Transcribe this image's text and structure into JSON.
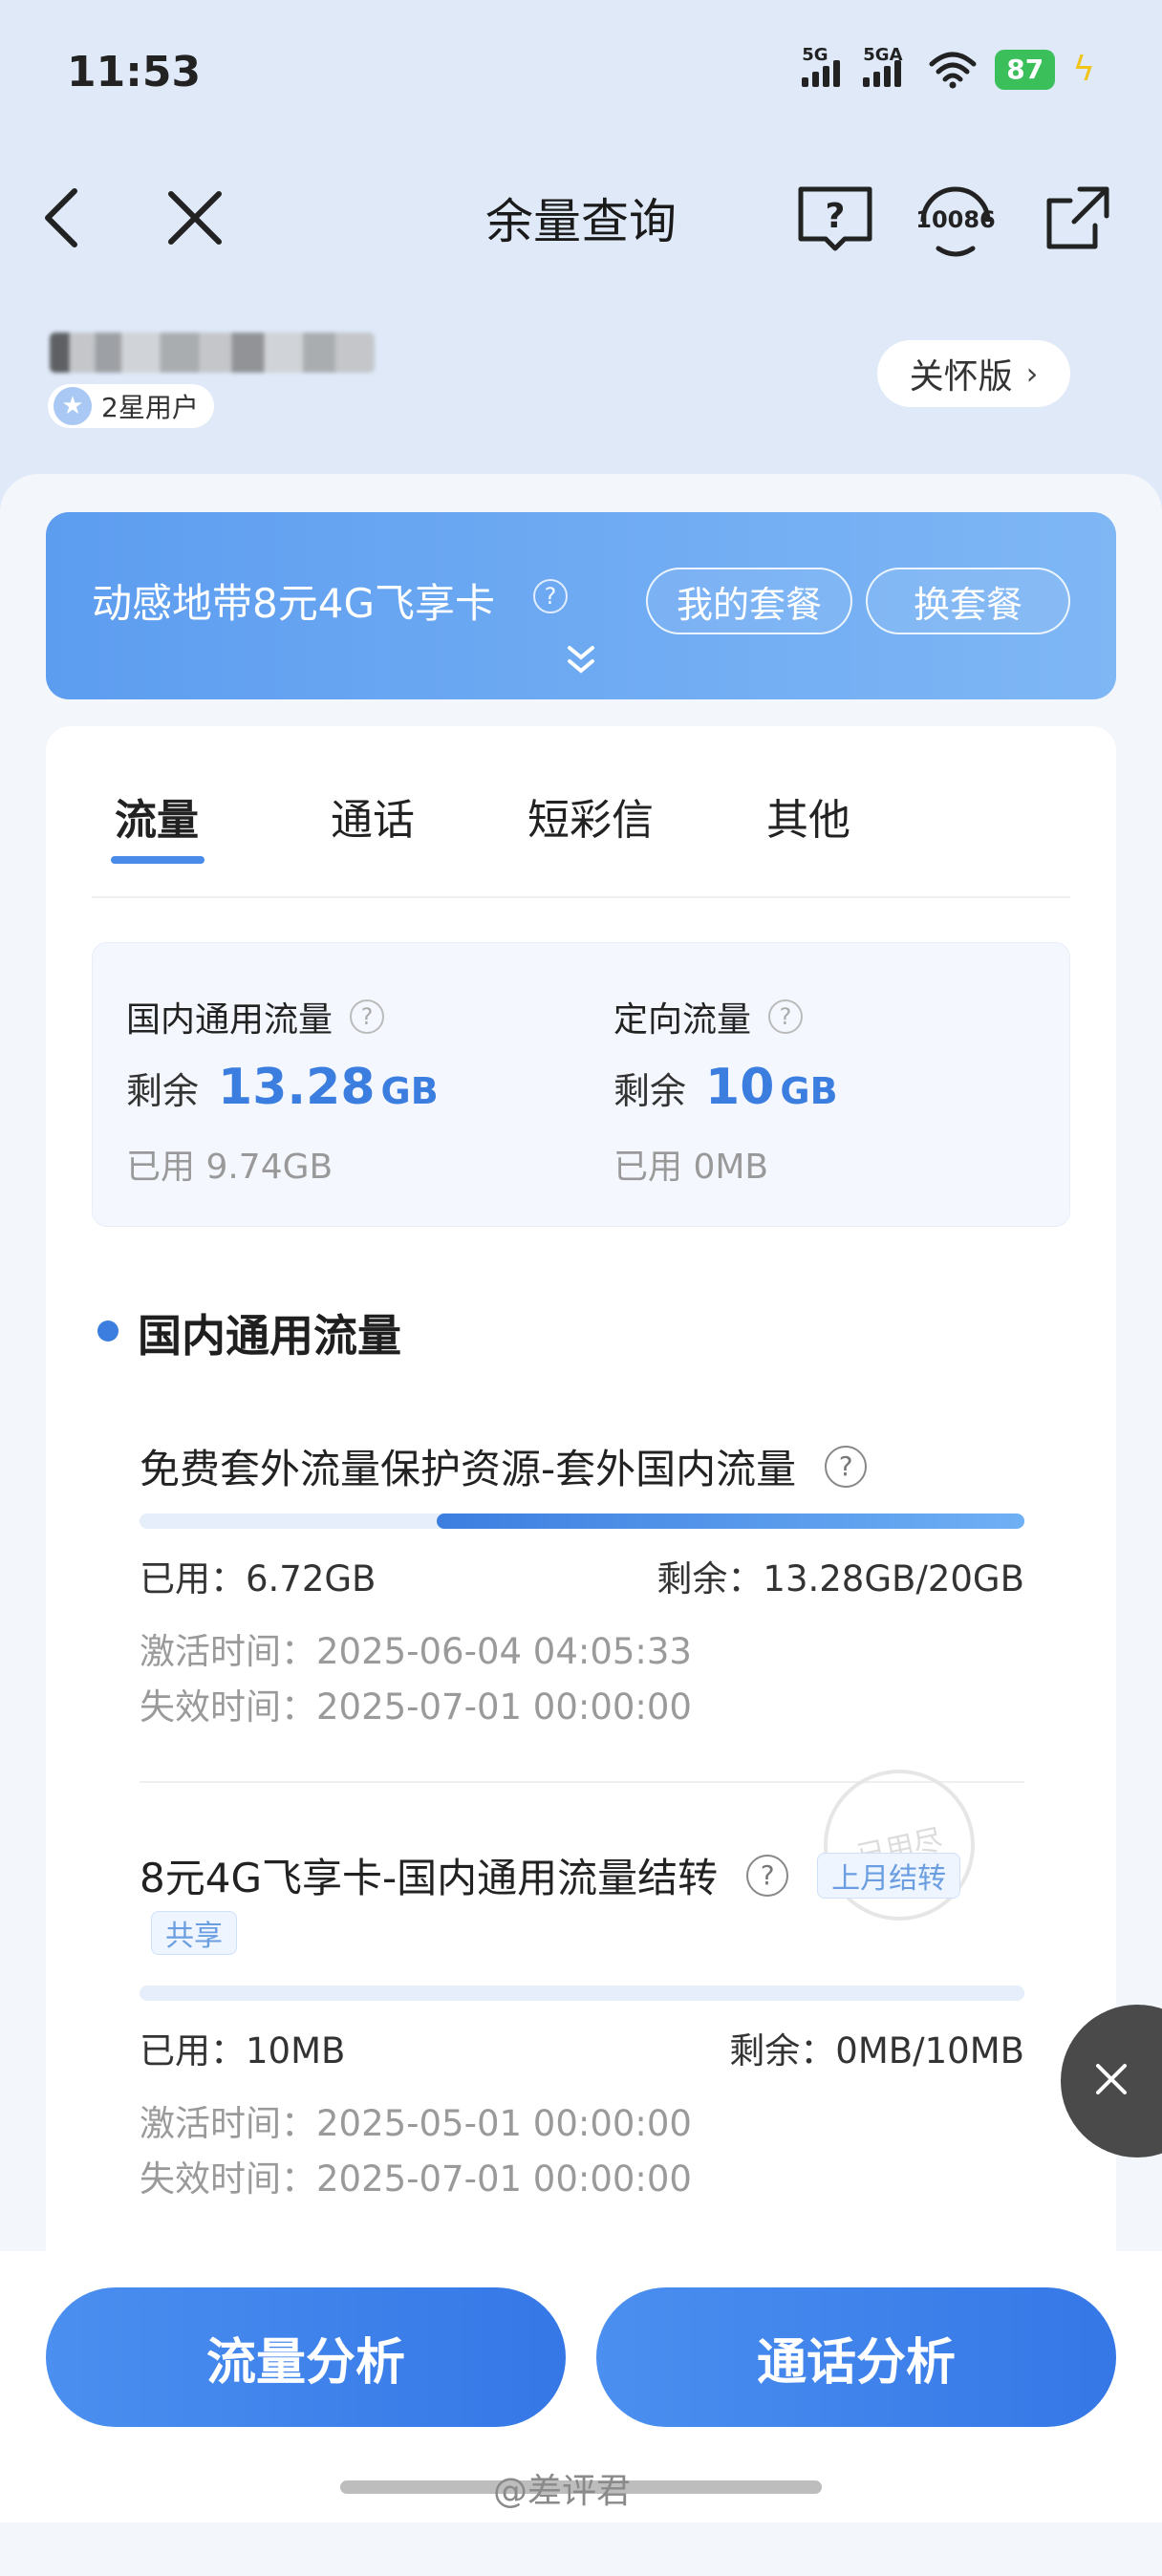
{
  "status": {
    "time": "11:53",
    "sig1_label": "5G",
    "sig2_label": "5GA",
    "battery": "87"
  },
  "nav": {
    "title": "余量查询",
    "back_icon": "chevron-left-icon",
    "close_icon": "close-icon",
    "help_icon": "help-book-icon",
    "service_label": "10086",
    "share_icon": "share-icon"
  },
  "user": {
    "level": "2星用户",
    "care_label": "关怀版"
  },
  "plan": {
    "name": "动感地带8元4G飞享卡",
    "my_plan": "我的套餐",
    "change_plan": "换套餐"
  },
  "tabs": [
    "流量",
    "通话",
    "短彩信",
    "其他"
  ],
  "summary": {
    "general": {
      "title": "国内通用流量",
      "remain_label": "剩余",
      "remain_value": "13.28",
      "remain_unit": "GB",
      "used": "已用  9.74GB"
    },
    "directed": {
      "title": "定向流量",
      "remain_label": "剩余",
      "remain_value": "10",
      "remain_unit": "GB",
      "used": "已用  0MB"
    }
  },
  "section_title": "国内通用流量",
  "items": [
    {
      "title": "免费套外流量保护资源-套外国内流量",
      "used": "已用：6.72GB",
      "remain": "剩余：13.28GB/20GB",
      "used_fraction": 0.336,
      "activate": "激活时间：2025-06-04 04:05:33",
      "expire": "失效时间：2025-07-01 00:00:00"
    },
    {
      "title": "8元4G飞享卡-国内通用流量结转",
      "tag_rollover": "上月结转",
      "tag_shared": "共享",
      "stamp": "已用尽",
      "used": "已用：10MB",
      "remain": "剩余：0MB/10MB",
      "used_fraction": 1.0,
      "activate": "激活时间：2025-05-01 00:00:00",
      "expire": "失效时间：2025-07-01 00:00:00"
    }
  ],
  "actions": {
    "traffic_analysis": "流量分析",
    "call_analysis": "通话分析"
  },
  "watermark": "@差评君",
  "colors": {
    "accent": "#3c7ee0",
    "battery": "#3bbf5a",
    "background": "#dfe9f8"
  }
}
